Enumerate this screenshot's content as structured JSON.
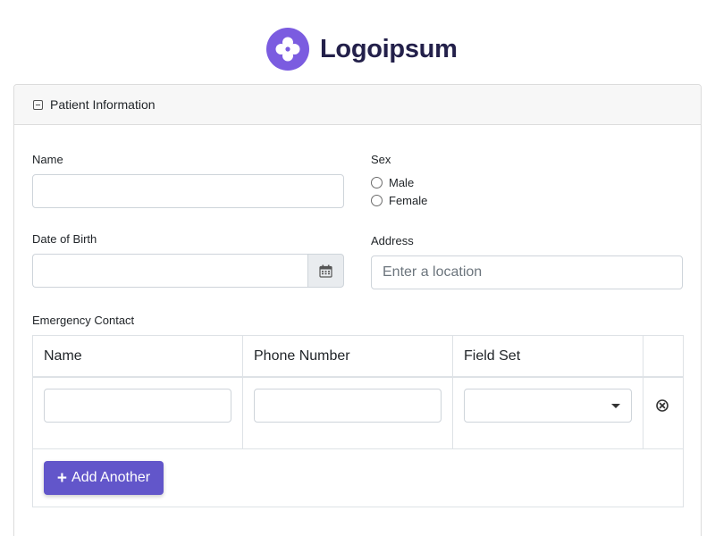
{
  "brand": {
    "name": "Logoipsum",
    "mark_color": "#7b5ce0",
    "text_color": "#23204a"
  },
  "panel": {
    "title": "Patient Information",
    "toggle_icon": "collapse-square-icon"
  },
  "form": {
    "name": {
      "label": "Name",
      "value": ""
    },
    "sex": {
      "label": "Sex",
      "options": [
        "Male",
        "Female"
      ],
      "selected": null
    },
    "dob": {
      "label": "Date of Birth",
      "value": "",
      "icon": "calendar-icon"
    },
    "address": {
      "label": "Address",
      "placeholder": "Enter a location",
      "value": ""
    }
  },
  "emergency": {
    "label": "Emergency Contact",
    "columns": [
      "Name",
      "Phone Number",
      "Field Set"
    ],
    "rows": [
      {
        "name": "",
        "phone": "",
        "field_set": ""
      }
    ],
    "remove_icon": "remove-circle-icon",
    "add_label": "Add Another",
    "add_color": "#6256ca"
  }
}
